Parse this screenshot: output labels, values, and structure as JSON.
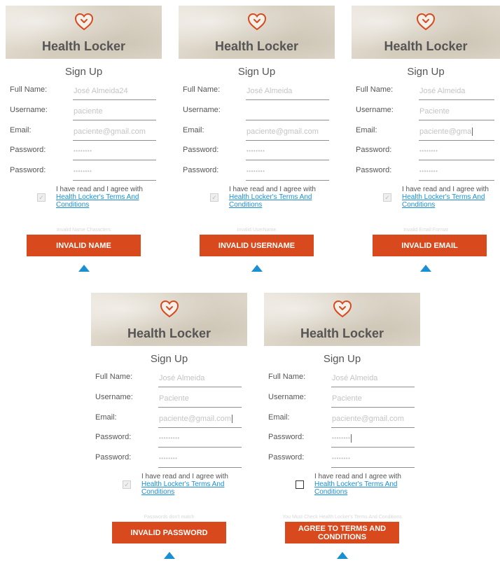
{
  "colors": {
    "accent": "#d84a1d",
    "link": "#1a8fd2",
    "arrow": "#1a8fd2"
  },
  "panels": [
    {
      "brand": "Health Locker",
      "title": "Sign Up",
      "labels": {
        "full_name": "Full Name:",
        "username": "Username:",
        "email": "Email:",
        "password": "Password:",
        "password2": "Password:"
      },
      "values": {
        "full_name": "José Almeida24",
        "username": "paciente",
        "email": "paciente@gmail.com",
        "password": "••••••••",
        "password2": "••••••••"
      },
      "agree_text": "I have read and I agree with",
      "agree_link": "Health Locker's Terms And Conditions",
      "checked": true,
      "error": "Invalid Name Characters",
      "button": "INVALID NAME"
    },
    {
      "brand": "Health Locker",
      "title": "Sign Up",
      "labels": {
        "full_name": "Full Name:",
        "username": "Username:",
        "email": "Email:",
        "password": "Password:",
        "password2": "Password:"
      },
      "values": {
        "full_name": "José Almeida",
        "username": "",
        "email": "paciente@gmail.com",
        "password": "••••••••",
        "password2": "••••••••"
      },
      "agree_text": "I have read and I agree with",
      "agree_link": "Health Locker's Terms And Conditions",
      "checked": true,
      "error": "Invalid UserName",
      "button": "INVALID USERNAME"
    },
    {
      "brand": "Health Locker",
      "title": "Sign Up",
      "labels": {
        "full_name": "Full Name:",
        "username": "Username:",
        "email": "Email:",
        "password": "Password:",
        "password2": "Password:"
      },
      "values": {
        "full_name": "José Almeida",
        "username": "Paciente",
        "email": "paciente@gma",
        "password": "••••••••",
        "password2": "••••••••"
      },
      "agree_text": "I have read and I agree with",
      "agree_link": "Health Locker's Terms And Conditions",
      "checked": true,
      "error": "Invalid Email Format",
      "button": "INVALID EMAIL"
    },
    {
      "brand": "Health Locker",
      "title": "Sign Up",
      "labels": {
        "full_name": "Full Name:",
        "username": "Username:",
        "email": "Email:",
        "password": "Password:",
        "password2": "Password:"
      },
      "values": {
        "full_name": "José Almeida",
        "username": "Paciente",
        "email": "paciente@gmail.com",
        "password": "•••••••••",
        "password2": "••••••••"
      },
      "agree_text": "I have read and I agree with",
      "agree_link": "Health Locker's Terms And Conditions",
      "checked": true,
      "error": "Passwords don't match",
      "button": "INVALID PASSWORD"
    },
    {
      "brand": "Health Locker",
      "title": "Sign Up",
      "labels": {
        "full_name": "Full Name:",
        "username": "Username:",
        "email": "Email:",
        "password": "Password:",
        "password2": "Password:"
      },
      "values": {
        "full_name": "José Almeida",
        "username": "Paciente",
        "email": "paciente@gmail.com",
        "password": "••••••••",
        "password2": "••••••••"
      },
      "agree_text": "I have read and I agree with",
      "agree_link": "Health Locker's Terms And Conditions",
      "checked": false,
      "error": "You Must Check Health Locker's Terms And Conditions",
      "button": "AGREE TO TERMS AND CONDITIONS"
    }
  ]
}
